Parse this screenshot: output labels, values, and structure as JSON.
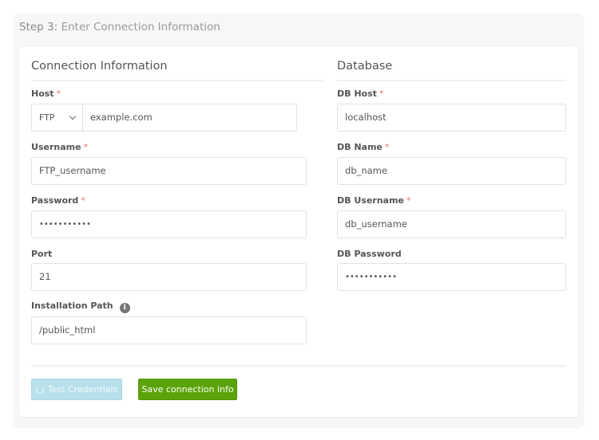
{
  "step": {
    "number_label": "Step 3:",
    "title": "Enter Connection Information"
  },
  "connection": {
    "section_title": "Connection Information",
    "host": {
      "label": "Host",
      "required": "*",
      "protocol": "FTP",
      "value": "example.com"
    },
    "username": {
      "label": "Username",
      "required": "*",
      "value": "FTP_username"
    },
    "password": {
      "label": "Password",
      "required": "*",
      "value": "•••••••••••"
    },
    "port": {
      "label": "Port",
      "value": "21"
    },
    "installation_path": {
      "label": "Installation Path",
      "info_icon": "i",
      "value": "/public_html"
    }
  },
  "database": {
    "section_title": "Database",
    "db_host": {
      "label": "DB Host",
      "required": "*",
      "value": "localhost"
    },
    "db_name": {
      "label": "DB Name",
      "required": "*",
      "value": "db_name"
    },
    "db_username": {
      "label": "DB Username",
      "required": "*",
      "value": "db_username"
    },
    "db_password": {
      "label": "DB Password",
      "value": "•••••••••••"
    }
  },
  "buttons": {
    "test_label": "Test Credentials",
    "save_label": "Save connection info"
  },
  "colors": {
    "save_button": "#5ba30a",
    "test_button": "#b7e0ea",
    "required_asterisk": "#e57373"
  }
}
